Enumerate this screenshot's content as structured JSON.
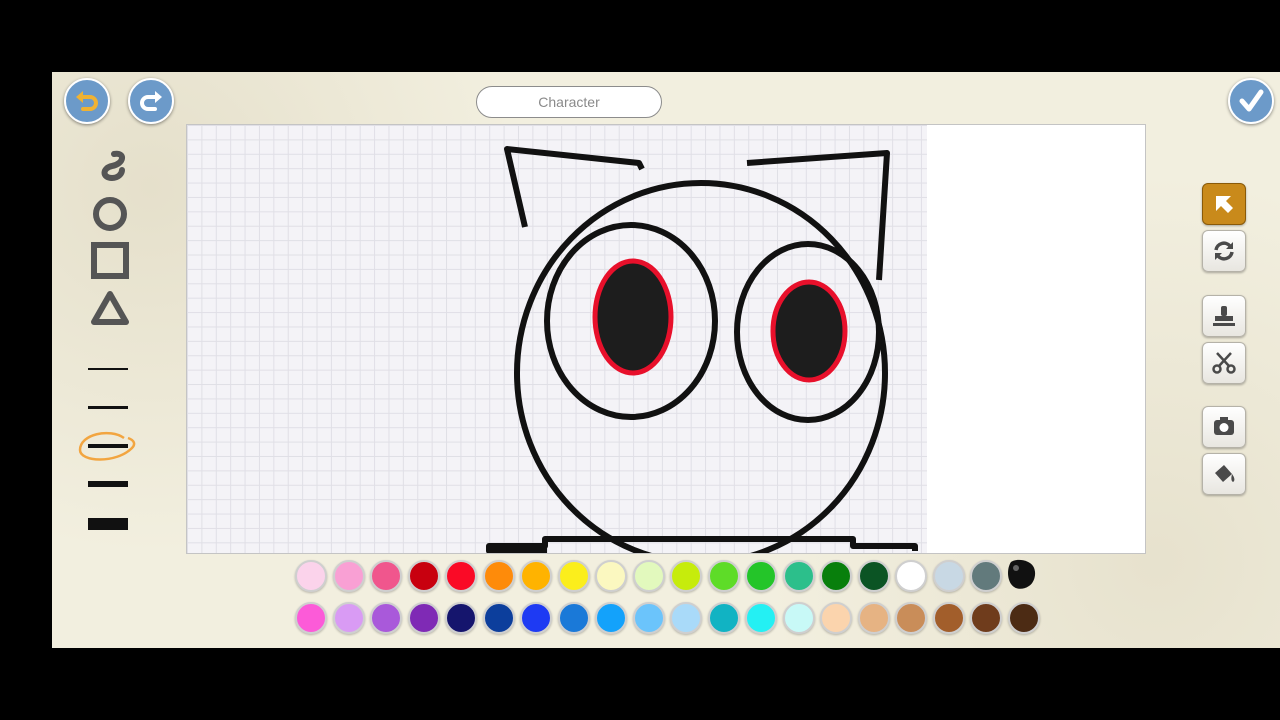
{
  "project": {
    "name_placeholder": "Character"
  },
  "canvas": {
    "stroke_color": "#111111",
    "eye_ring_color": "#e8102b"
  },
  "line_widths": [
    2,
    3,
    4,
    6,
    12
  ],
  "selected_line_width": 4,
  "palette": {
    "row1": [
      "#fbd3eb",
      "#f9a0d4",
      "#f0568d",
      "#c8000f",
      "#fa0a26",
      "#fe8b0a",
      "#ffb300",
      "#fbee1c",
      "#fbf8c0",
      "#e2f9bd",
      "#c6ec0c",
      "#5edc28",
      "#24c529",
      "#2cbf8b",
      "#087f0c",
      "#0b5424",
      "#ffffff",
      "#c8d8e4",
      "#627a7c"
    ],
    "row2": [
      "#fc5bd8",
      "#d99bf4",
      "#a959da",
      "#7f2ab5",
      "#15156d",
      "#0c3e9c",
      "#1e3af3",
      "#1a79d8",
      "#13a2fb",
      "#6bc4fb",
      "#a9daf9",
      "#11b3c3",
      "#24f0f3",
      "#c8f9f7",
      "#fbd4ad",
      "#e6b383",
      "#c98d59",
      "#a25e2b",
      "#6f3c1c",
      "#4c2b14"
    ],
    "ink_swatch_color": "#111111"
  }
}
